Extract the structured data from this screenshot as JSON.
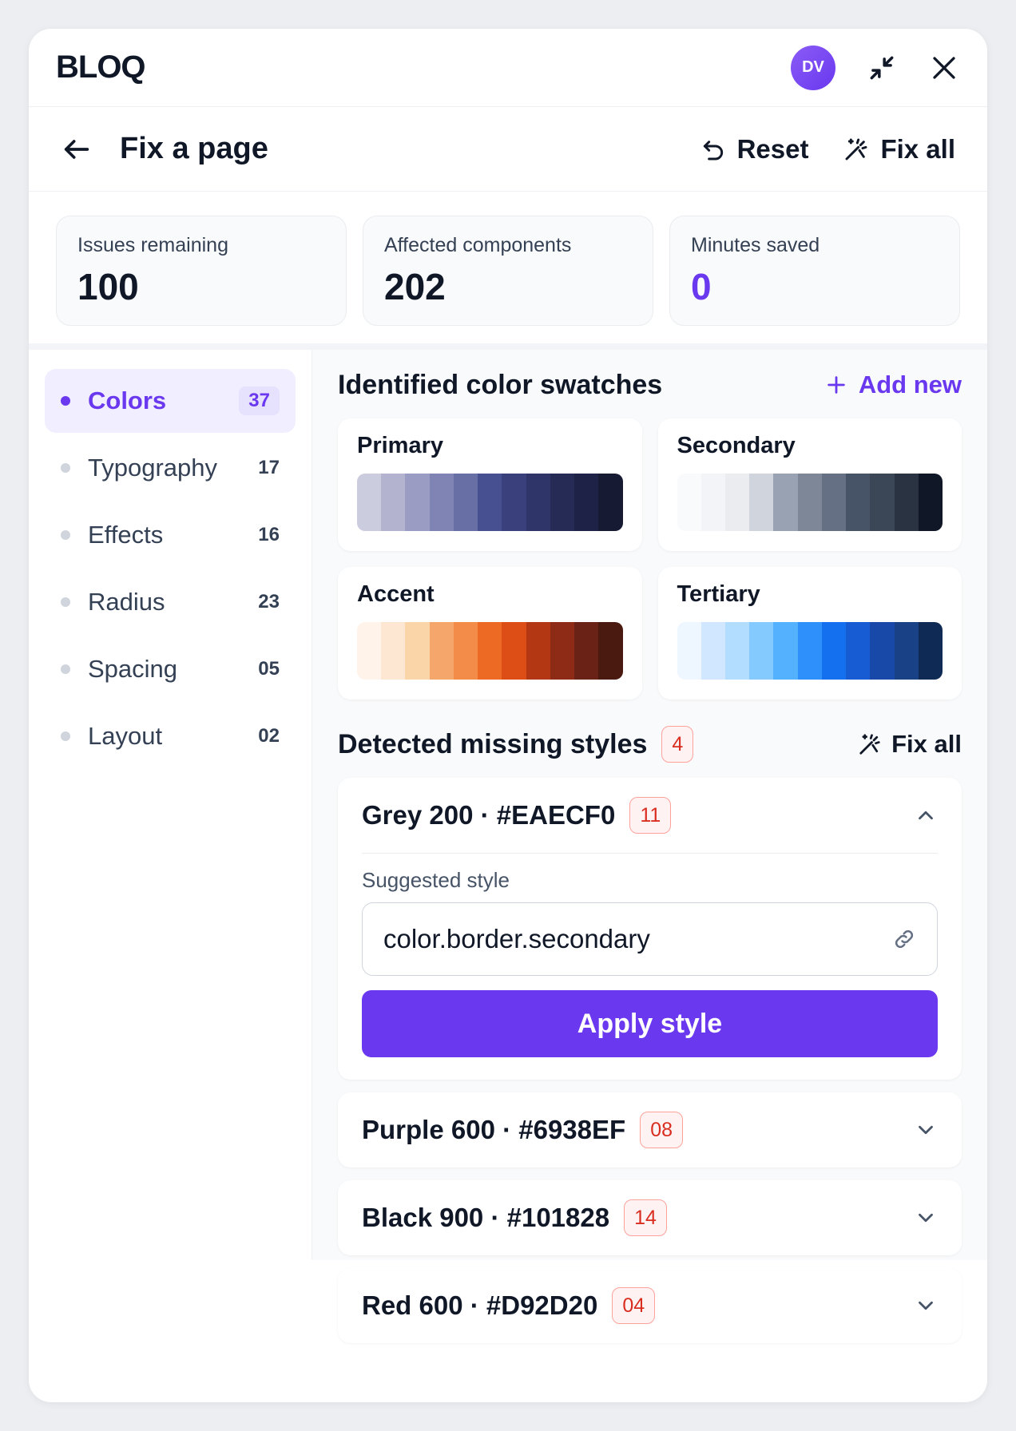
{
  "app": {
    "logo": "BLOQ",
    "avatar_initials": "DV"
  },
  "header": {
    "title": "Fix a page",
    "reset_label": "Reset",
    "fix_all_label": "Fix all"
  },
  "stats": [
    {
      "label": "Issues remaining",
      "value": "100"
    },
    {
      "label": "Affected components",
      "value": "202"
    },
    {
      "label": "Minutes saved",
      "value": "0"
    }
  ],
  "sidebar": {
    "items": [
      {
        "label": "Colors",
        "count": "37"
      },
      {
        "label": "Typography",
        "count": "17"
      },
      {
        "label": "Effects",
        "count": "16"
      },
      {
        "label": "Radius",
        "count": "23"
      },
      {
        "label": "Spacing",
        "count": "05"
      },
      {
        "label": "Layout",
        "count": "02"
      }
    ]
  },
  "swatches": {
    "title": "Identified color swatches",
    "add_new_label": "Add new",
    "items": [
      {
        "name": "Primary",
        "colors": [
          "#ccccdf",
          "#b3b3d0",
          "#9a9cc3",
          "#8084b5",
          "#676fa5",
          "#475090",
          "#3a407c",
          "#2f3568",
          "#262b56",
          "#1e2246",
          "#161a33"
        ]
      },
      {
        "name": "Secondary",
        "colors": [
          "#f9fafb",
          "#f2f4f7",
          "#eaecf0",
          "#d0d5dd",
          "#98a2b3",
          "#7e8797",
          "#667085",
          "#475467",
          "#3b4657",
          "#2a3342",
          "#101828"
        ]
      },
      {
        "name": "Accent",
        "colors": [
          "#fff3ea",
          "#fde7d2",
          "#f9d5a8",
          "#f4a66b",
          "#f28c48",
          "#ec6a23",
          "#dd4e16",
          "#b43714",
          "#8e2b17",
          "#6b2216",
          "#4a1910"
        ]
      },
      {
        "name": "Tertiary",
        "colors": [
          "#eef6ff",
          "#d1e7ff",
          "#b2ddff",
          "#84caff",
          "#53b1fd",
          "#2e90fa",
          "#1570ef",
          "#175cd3",
          "#1849a9",
          "#194185",
          "#102a56"
        ]
      }
    ]
  },
  "missing": {
    "title": "Detected missing styles",
    "count": "4",
    "fix_all_label": "Fix all",
    "items": [
      {
        "name": "Grey 200 · #EAECF0",
        "count": "11",
        "expanded": true,
        "suggested_label": "Suggested style",
        "suggested_value": "color.border.secondary",
        "apply_label": "Apply style"
      },
      {
        "name": "Purple 600 · #6938EF",
        "count": "08"
      },
      {
        "name": "Black 900 · #101828",
        "count": "14"
      },
      {
        "name": "Red 600 · #D92D20",
        "count": "04"
      }
    ]
  },
  "colors": {
    "accent": "#6938ef",
    "danger": "#d92d20"
  },
  "icons": [
    "minimize-icon",
    "close-icon",
    "back-arrow-icon",
    "reset-icon",
    "magic-wand-icon",
    "plus-icon",
    "chevron-up-icon",
    "chevron-down-icon",
    "link-icon"
  ]
}
